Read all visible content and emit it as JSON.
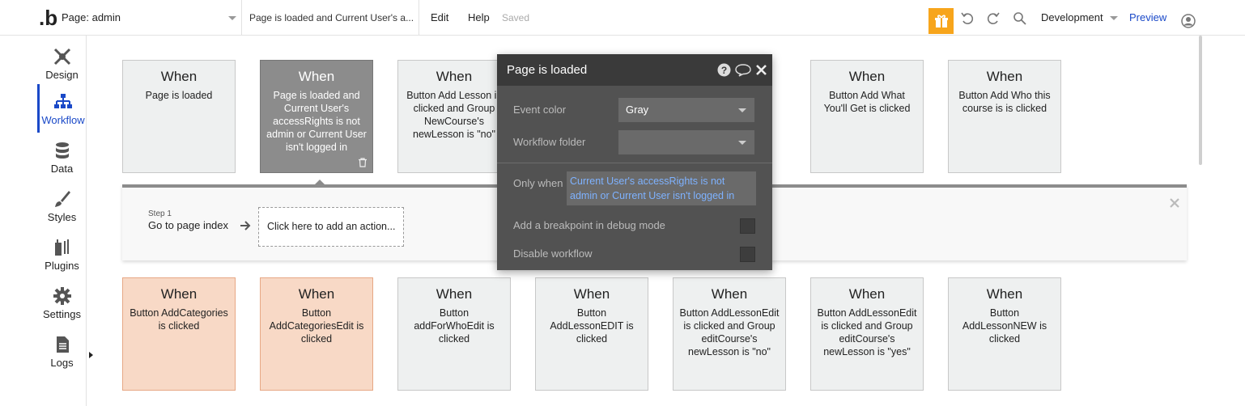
{
  "app": {
    "logo": ".b",
    "page_select": "Page: admin",
    "workflow_select": "Page is loaded and Current User's a...",
    "menu": {
      "edit": "Edit",
      "help": "Help"
    },
    "saved_status": "Saved",
    "environment": "Development",
    "preview": "Preview"
  },
  "sidebar": {
    "items": [
      {
        "label": "Design",
        "icon": "design-icon"
      },
      {
        "label": "Workflow",
        "icon": "workflow-icon",
        "active": true
      },
      {
        "label": "Data",
        "icon": "database-icon"
      },
      {
        "label": "Styles",
        "icon": "brush-icon"
      },
      {
        "label": "Plugins",
        "icon": "plugins-icon"
      },
      {
        "label": "Settings",
        "icon": "gear-icon"
      },
      {
        "label": "Logs",
        "icon": "document-icon"
      }
    ]
  },
  "events_top": [
    {
      "when": "When",
      "desc": "Page is loaded"
    },
    {
      "when": "When",
      "desc": "Page is loaded and Current User's accessRights is not admin or Current User isn't logged in",
      "selected": true
    },
    {
      "when": "When",
      "desc": "Button Add Lesson is clicked and Group NewCourse's newLesson is \"no\""
    },
    {
      "when": "When",
      "desc": "Button Add What You'll Get is clicked"
    },
    {
      "when": "When",
      "desc": "Button Add Who this course is is clicked"
    }
  ],
  "events_bottom": [
    {
      "when": "When",
      "desc": "Button AddCategories is clicked",
      "color": "orange"
    },
    {
      "when": "When",
      "desc": "Button AddCategoriesEdit is clicked",
      "color": "orange"
    },
    {
      "when": "When",
      "desc": "Button addForWhoEdit is clicked"
    },
    {
      "when": "When",
      "desc": "Button AddLessonEDIT is clicked"
    },
    {
      "when": "When",
      "desc": "Button AddLessonEdit is clicked and Group editCourse's newLesson is \"no\""
    },
    {
      "when": "When",
      "desc": "Button AddLessonEdit is clicked and Group editCourse's newLesson is \"yes\""
    },
    {
      "when": "When",
      "desc": "Button AddLessonNEW is clicked"
    }
  ],
  "steps": {
    "step1_label": "Step 1",
    "step1_action": "Go to page index",
    "add_action": "Click here to add an action..."
  },
  "editor": {
    "title": "Page is loaded",
    "event_color_label": "Event color",
    "event_color_value": "Gray",
    "folder_label": "Workflow folder",
    "folder_value": "",
    "only_when_label": "Only when",
    "only_when_value": "Current User's accessRights is not admin or Current User isn't logged in",
    "breakpoint_label": "Add a breakpoint in debug mode",
    "disable_label": "Disable workflow"
  },
  "colors": {
    "accent": "#1a49c8",
    "gift": "#f7a51c",
    "orange_event": "#f8d9c6",
    "selected_event": "#8c8c8c",
    "condition_text": "#7eb2ff"
  }
}
